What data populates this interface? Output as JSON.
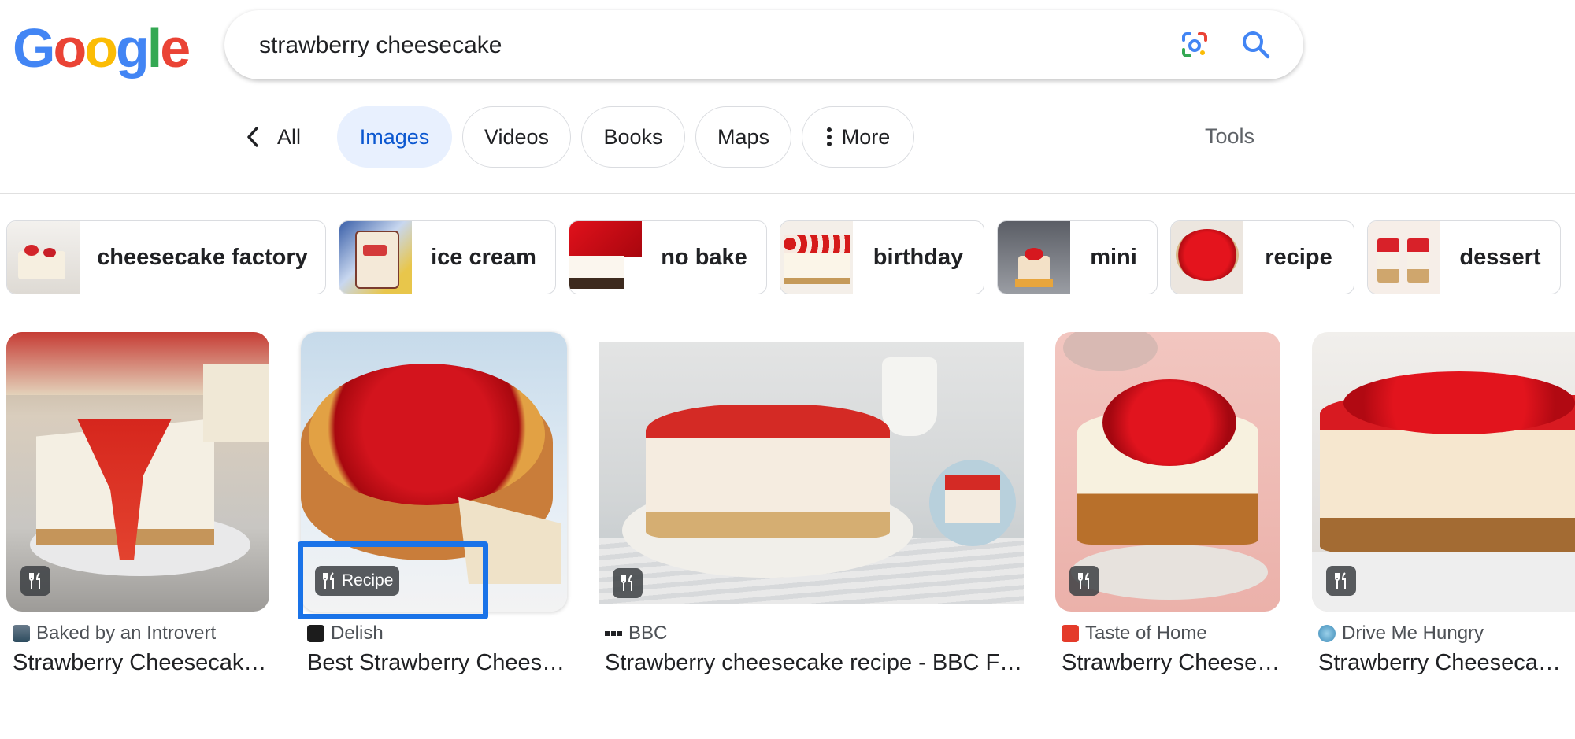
{
  "logo": {
    "letters": [
      "G",
      "o",
      "o",
      "g",
      "l",
      "e"
    ],
    "colors": [
      "#4285F4",
      "#EA4335",
      "#FBBC05",
      "#4285F4",
      "#34A853",
      "#EA4335"
    ]
  },
  "search": {
    "query": "strawberry cheesecake"
  },
  "tabs": {
    "back_label": "All",
    "items": [
      {
        "label": "Images",
        "active": true
      },
      {
        "label": "Videos",
        "active": false
      },
      {
        "label": "Books",
        "active": false
      },
      {
        "label": "Maps",
        "active": false
      },
      {
        "label": "More",
        "active": false
      }
    ],
    "tools": "Tools"
  },
  "related": [
    {
      "label": "cheesecake factory"
    },
    {
      "label": "ice cream"
    },
    {
      "label": "no bake"
    },
    {
      "label": "birthday"
    },
    {
      "label": "mini"
    },
    {
      "label": "recipe"
    },
    {
      "label": "dessert"
    }
  ],
  "results": [
    {
      "source": "Baked by an Introvert",
      "title": "Strawberry Cheesecake…",
      "badge": ""
    },
    {
      "source": "Delish",
      "title": "Best Strawberry Cheese…",
      "badge": "Recipe"
    },
    {
      "source": "BBC",
      "title": "Strawberry cheesecake recipe - BBC Fo…",
      "badge": ""
    },
    {
      "source": "Taste of Home",
      "title": "Strawberry Cheese…",
      "badge": ""
    },
    {
      "source": "Drive Me Hungry",
      "title": "Strawberry Cheesecake…",
      "badge": ""
    }
  ],
  "colors": {
    "accent": "#0b57d0",
    "active_tab_bg": "#e8f0fe",
    "highlight": "#1a73e8"
  }
}
